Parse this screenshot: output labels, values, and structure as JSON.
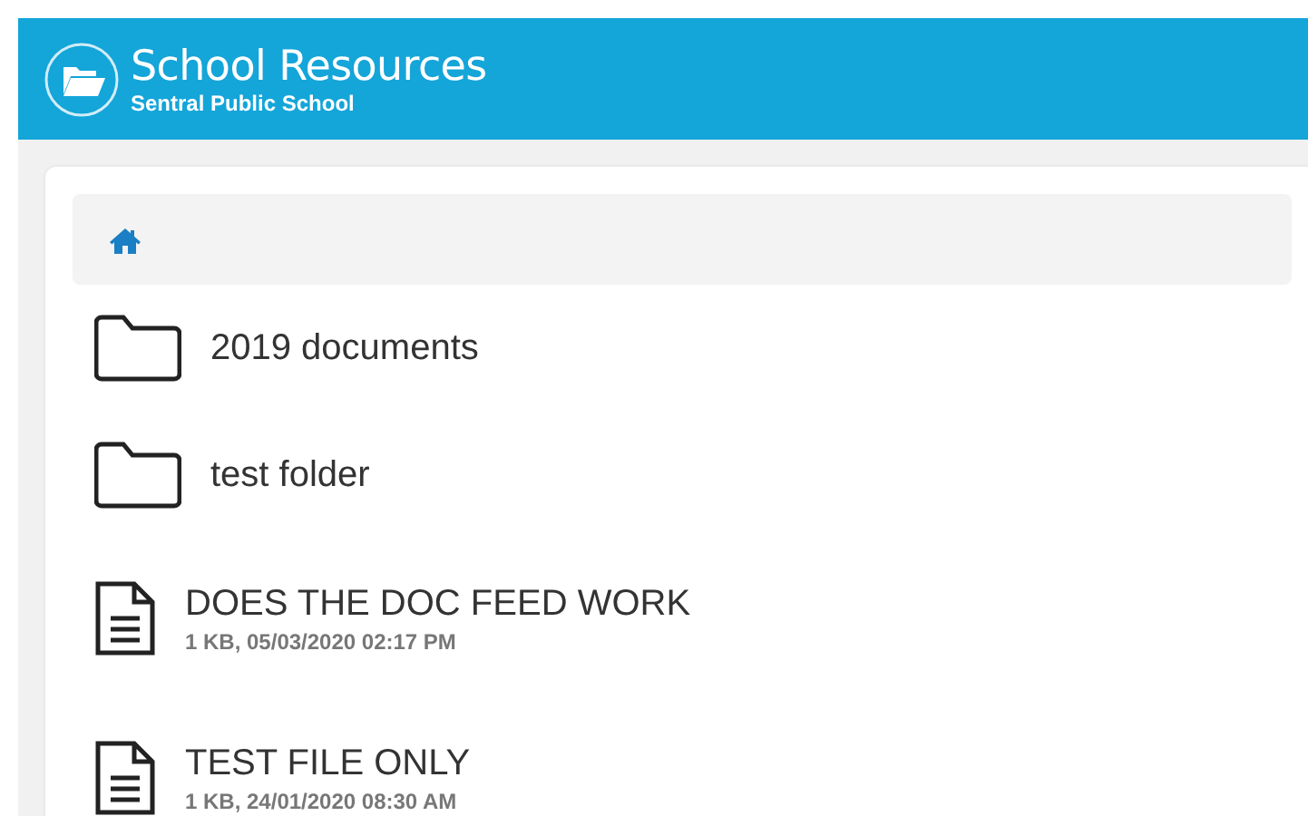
{
  "header": {
    "title": "School Resources",
    "subtitle": "Sentral Public School"
  },
  "breadcrumb": {
    "kind": "home"
  },
  "items": [
    {
      "kind": "folder",
      "name": "2019 documents"
    },
    {
      "kind": "folder",
      "name": "test folder"
    },
    {
      "kind": "file",
      "name": "DOES THE DOC FEED WORK",
      "meta": "1 KB, 05/03/2020 02:17 PM"
    },
    {
      "kind": "file",
      "name": "TEST FILE ONLY",
      "meta": "1 KB, 24/01/2020 08:30 AM"
    }
  ]
}
